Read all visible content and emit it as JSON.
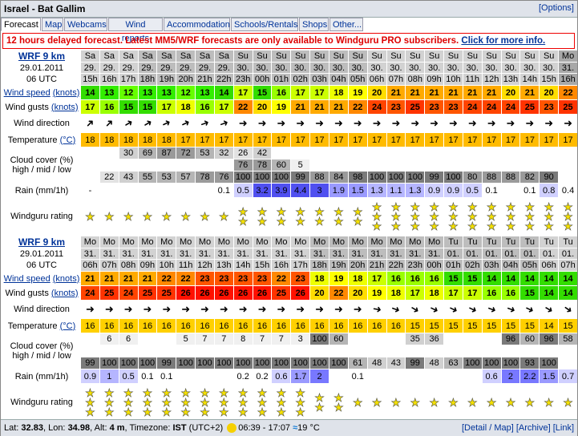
{
  "header": {
    "title": "Israel - Bat Gallim",
    "options": "[Options]"
  },
  "tabs": [
    "Forecast",
    "Map",
    "Webcams",
    "Wind reports",
    "Accommodation",
    "Schools/Rentals",
    "Shops",
    "Other..."
  ],
  "notice": {
    "text": "12 hours delayed forecast. Latest MM5/WRF forecasts are only available to Windguru PRO subscribers.",
    "link": "Click for more info."
  },
  "labels": {
    "model": "WRF 9 km",
    "date": "29.01.2011",
    "utc": "06 UTC",
    "wind_speed": "Wind speed",
    "wind_gusts": "Wind gusts",
    "knots": "(knots)",
    "wind_direction": "Wind direction",
    "temperature": "Temperature",
    "celsius": "(°C)",
    "cloud_cover": "Cloud cover (%)",
    "cloud_levels": "high / mid / low",
    "rain": "Rain (mm/1h)",
    "rating": "Windguru rating"
  },
  "blocks": [
    {
      "days": [
        "Sa",
        "Sa",
        "Sa",
        "Sa",
        "Sa",
        "Sa",
        "Sa",
        "Sa",
        "Su",
        "Su",
        "Su",
        "Su",
        "Su",
        "Su",
        "Su",
        "Su",
        "Su",
        "Su",
        "Su",
        "Su",
        "Su",
        "Su",
        "Su",
        "Su",
        "Su",
        "Mo"
      ],
      "dates": [
        "29.",
        "29.",
        "29.",
        "29.",
        "29.",
        "29.",
        "29.",
        "29.",
        "30.",
        "30.",
        "30.",
        "30.",
        "30.",
        "30.",
        "30.",
        "30.",
        "30.",
        "30.",
        "30.",
        "30.",
        "30.",
        "30.",
        "30.",
        "30.",
        "30.",
        "31."
      ],
      "hours": [
        "15h",
        "16h",
        "17h",
        "18h",
        "19h",
        "20h",
        "21h",
        "22h",
        "23h",
        "00h",
        "01h",
        "02h",
        "03h",
        "04h",
        "05h",
        "06h",
        "07h",
        "08h",
        "09h",
        "10h",
        "11h",
        "12h",
        "13h",
        "14h",
        "15h",
        "16h"
      ],
      "speed": [
        14,
        13,
        12,
        13,
        13,
        12,
        13,
        14,
        17,
        15,
        16,
        17,
        17,
        18,
        19,
        20,
        21,
        21,
        21,
        21,
        21,
        21,
        20,
        21,
        20,
        22
      ],
      "gusts": [
        17,
        16,
        15,
        15,
        17,
        18,
        16,
        17,
        22,
        20,
        19,
        21,
        21,
        21,
        22,
        24,
        23,
        25,
        23,
        23,
        24,
        24,
        24,
        25,
        23,
        25
      ],
      "dir": [
        -45,
        -45,
        -30,
        -30,
        -25,
        -25,
        -20,
        -20,
        0,
        0,
        0,
        0,
        0,
        0,
        0,
        0,
        0,
        0,
        0,
        0,
        0,
        0,
        0,
        0,
        0,
        0
      ],
      "temp": [
        18,
        18,
        18,
        18,
        18,
        17,
        17,
        17,
        17,
        17,
        17,
        17,
        17,
        17,
        17,
        17,
        17,
        17,
        17,
        17,
        17,
        17,
        17,
        17,
        17,
        17
      ],
      "cloud_high": [
        "",
        "",
        "30",
        "69",
        "87",
        "72",
        "53",
        "32",
        "26",
        "42",
        "",
        "",
        "",
        "",
        "",
        "",
        "",
        "",
        "",
        "",
        "",
        "",
        "",
        "",
        "",
        ""
      ],
      "cloud_mid": [
        "",
        "",
        "",
        "",
        "",
        "",
        "",
        "",
        "76",
        "78",
        "60",
        "5",
        "",
        "",
        "",
        "",
        "",
        "",
        "",
        "",
        "",
        "",
        "",
        "",
        "",
        ""
      ],
      "cloud_low": [
        "",
        "22",
        "43",
        "55",
        "53",
        "57",
        "78",
        "76",
        "100",
        "100",
        "100",
        "99",
        "88",
        "84",
        "98",
        "100",
        "100",
        "100",
        "99",
        "100",
        "80",
        "88",
        "88",
        "82",
        "90",
        ""
      ],
      "rain": [
        "-",
        "",
        "",
        "",
        "",
        "",
        "",
        "0.1",
        "0.5",
        "3.2",
        "3.9",
        "4.4",
        "3",
        "1.9",
        "1.5",
        "1.3",
        "1.1",
        "1.3",
        "0.9",
        "0.9",
        "0.5",
        "0.1",
        "",
        "0.1",
        "0.8",
        "0.4"
      ],
      "rating": [
        1,
        1,
        1,
        1,
        1,
        1,
        1,
        1,
        2,
        2,
        2,
        2,
        2,
        2,
        2,
        3,
        3,
        3,
        3,
        3,
        3,
        3,
        3,
        3,
        3,
        3
      ]
    },
    {
      "days": [
        "Mo",
        "Mo",
        "Mo",
        "Mo",
        "Mo",
        "Mo",
        "Mo",
        "Mo",
        "Mo",
        "Mo",
        "Mo",
        "Mo",
        "Mo",
        "Mo",
        "Mo",
        "Mo",
        "Mo",
        "Mo",
        "Mo",
        "Tu",
        "Tu",
        "Tu",
        "Tu",
        "Tu",
        "Tu",
        "Tu"
      ],
      "dates": [
        "31.",
        "31.",
        "31.",
        "31.",
        "31.",
        "31.",
        "31.",
        "31.",
        "31.",
        "31.",
        "31.",
        "31.",
        "31.",
        "31.",
        "31.",
        "31.",
        "31.",
        "31.",
        "31.",
        "01.",
        "01.",
        "01.",
        "01.",
        "01.",
        "01.",
        "01."
      ],
      "hours": [
        "06h",
        "07h",
        "08h",
        "09h",
        "10h",
        "11h",
        "12h",
        "13h",
        "14h",
        "15h",
        "16h",
        "17h",
        "18h",
        "19h",
        "20h",
        "21h",
        "22h",
        "23h",
        "00h",
        "01h",
        "02h",
        "03h",
        "04h",
        "05h",
        "06h",
        "07h"
      ],
      "speed": [
        21,
        21,
        21,
        21,
        22,
        22,
        23,
        23,
        23,
        23,
        22,
        23,
        18,
        19,
        18,
        17,
        16,
        16,
        16,
        15,
        15,
        14,
        14,
        14,
        14,
        14
      ],
      "gusts": [
        24,
        25,
        24,
        25,
        25,
        26,
        26,
        26,
        26,
        26,
        25,
        26,
        20,
        22,
        20,
        19,
        18,
        17,
        18,
        17,
        17,
        16,
        16,
        15,
        14,
        14
      ],
      "dir": [
        0,
        0,
        0,
        0,
        0,
        0,
        0,
        0,
        0,
        0,
        0,
        0,
        0,
        0,
        0,
        10,
        20,
        30,
        25,
        25,
        25,
        20,
        20,
        25,
        30,
        35
      ],
      "temp": [
        16,
        16,
        16,
        16,
        16,
        16,
        16,
        16,
        16,
        16,
        16,
        16,
        16,
        16,
        16,
        16,
        16,
        15,
        15,
        15,
        15,
        15,
        15,
        15,
        14,
        15
      ],
      "cloud_high": [
        "",
        "6",
        "6",
        "",
        "",
        "5",
        "7",
        "7",
        "8",
        "7",
        "7",
        "3",
        "100",
        "60",
        "",
        "",
        "",
        "35",
        "36",
        "",
        "",
        "",
        "96",
        "60",
        "96",
        "58"
      ],
      "cloud_mid": [
        "",
        "",
        "",
        "",
        "",
        "",
        "",
        "",
        "",
        "",
        "",
        "",
        "",
        "",
        "",
        "",
        "",
        "",
        "",
        "",
        "",
        "",
        "",
        "",
        "",
        ""
      ],
      "cloud_low": [
        "99",
        "100",
        "100",
        "100",
        "99",
        "100",
        "100",
        "100",
        "100",
        "100",
        "100",
        "100",
        "100",
        "100",
        "61",
        "48",
        "43",
        "99",
        "48",
        "63",
        "100",
        "100",
        "100",
        "93",
        "100",
        ""
      ],
      "rain": [
        "0.9",
        "1",
        "0.5",
        "0.1",
        "0.1",
        "",
        "",
        "",
        "0.2",
        "0.2",
        "0.6",
        "1.7",
        "2",
        "",
        "0.1",
        "",
        "",
        "",
        "",
        "",
        "",
        "0.6",
        "2",
        "2.2",
        "1.5",
        "0.7"
      ],
      "rating": [
        3,
        3,
        3,
        3,
        3,
        3,
        3,
        3,
        3,
        3,
        3,
        3,
        2,
        2,
        1,
        1,
        1,
        1,
        1,
        1,
        1,
        1,
        1,
        1,
        1,
        1
      ]
    }
  ],
  "footer": {
    "lat_label": "Lat:",
    "lat": "32.83",
    "lon_label": "Lon:",
    "lon": "34.98",
    "alt_label": "Alt:",
    "alt": "4 m",
    "tz_label": "Timezone:",
    "tz": "IST",
    "tz_offset": "(UTC+2)",
    "sun": "06:39 - 17:07",
    "water": "19 °C",
    "links": [
      "[Detail / Map]",
      "[Archive]",
      "[Link]"
    ]
  },
  "colors": {
    "light_green": "#66ff00",
    "mid_green": "#33cc00",
    "yellow": "#ffff00",
    "orange": "#ffaa00",
    "red": "#ff3300",
    "deep_red": "#ff0000",
    "rain_blue": "#5b5bff"
  }
}
